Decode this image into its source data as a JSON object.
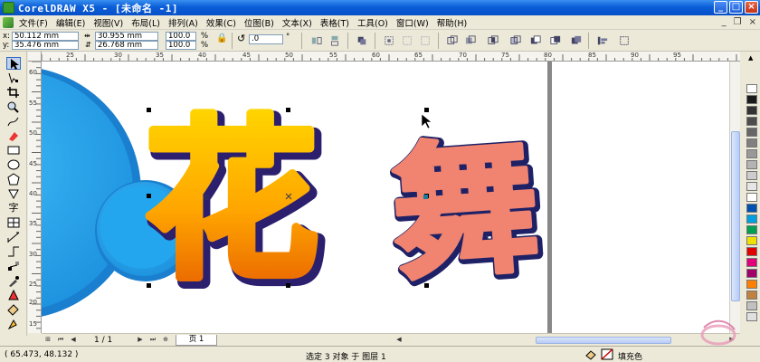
{
  "window": {
    "title": "CorelDRAW X5 - [未命名 -1]"
  },
  "menu": {
    "items": [
      "文件(F)",
      "编辑(E)",
      "视图(V)",
      "布局(L)",
      "排列(A)",
      "效果(C)",
      "位图(B)",
      "文本(X)",
      "表格(T)",
      "工具(O)",
      "窗口(W)",
      "帮助(H)"
    ]
  },
  "properties": {
    "x_label": "x:",
    "y_label": "y:",
    "x": "50.112 mm",
    "y": "35.476 mm",
    "width": "30.955 mm",
    "height": "26.768 mm",
    "scale_w": "100.0",
    "scale_h": "100.0",
    "percent_w": "%",
    "percent_h": "%",
    "rotation": ".0",
    "degree": "°"
  },
  "ruler": {
    "top_ticks": [
      "25",
      "30",
      "35",
      "40",
      "45",
      "50",
      "55",
      "60",
      "65",
      "70",
      "75",
      "80",
      "85",
      "90",
      "95"
    ],
    "left_ticks": [
      "60",
      "55",
      "50",
      "45",
      "40",
      "35",
      "30",
      "25",
      "20",
      "15"
    ]
  },
  "artwork": {
    "char1": "花",
    "char2": "舞"
  },
  "navigator": {
    "page_count": "1 / 1",
    "page_tab": "页 1"
  },
  "palette": {
    "swatches": [
      "#ffffff",
      "#1a1a1a",
      "#333333",
      "#4d4d4d",
      "#666666",
      "#808080",
      "#999999",
      "#b3b3b3",
      "#cccccc",
      "#e6e6e6",
      "#ffffff",
      "#0050b0",
      "#00a0e0",
      "#00a050",
      "#f0e000",
      "#e00000",
      "#e0007a",
      "#a0006a",
      "#ff8000",
      "#c08040",
      "#c0c0c0",
      "#e0e0e0"
    ]
  },
  "status": {
    "coords": "( 65.473, 48.132 )",
    "selection": "选定 3 对象 于 图层 1",
    "fill": "填充色"
  }
}
